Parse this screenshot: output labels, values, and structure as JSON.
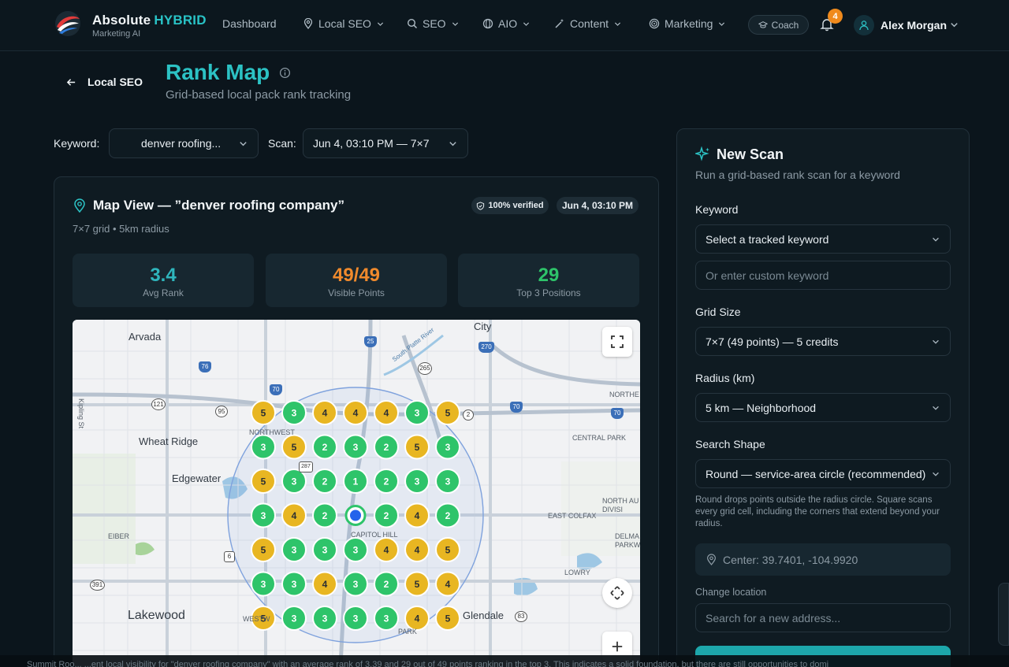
{
  "brand": {
    "name": "Absolute",
    "accent": "HYBRID",
    "sub": "Marketing AI"
  },
  "nav": {
    "items": [
      {
        "label": "Dashboard",
        "icon": "",
        "chevron": false
      },
      {
        "label": "Local SEO",
        "icon": "map-pin-icon",
        "chevron": true
      },
      {
        "label": "SEO",
        "icon": "search-icon",
        "chevron": true
      },
      {
        "label": "AIO",
        "icon": "globe-icon",
        "chevron": true
      },
      {
        "label": "Content",
        "icon": "magic-wand-icon",
        "chevron": true
      },
      {
        "label": "Marketing",
        "icon": "target-icon",
        "chevron": true
      }
    ],
    "coach": "Coach",
    "notifications": "4",
    "user": "Alex Morgan"
  },
  "header": {
    "back": "Local SEO",
    "title": "Rank Map",
    "subtitle": "Grid-based local pack rank tracking"
  },
  "filters": {
    "keyword_label": "Keyword:",
    "keyword_value": "denver roofing...",
    "scan_label": "Scan:",
    "scan_value": "Jun 4, 03:10 PM — 7×7"
  },
  "map_view": {
    "title": "Map View — ”denver roofing company”",
    "subtitle": "7×7 grid • 5km radius",
    "verified": "100% verified",
    "date": "Jun 4, 03:10 PM",
    "stats": [
      {
        "value": "3.4",
        "label": "Avg Rank",
        "color": "#2fb6bd"
      },
      {
        "value": "49/49",
        "label": "Visible Points",
        "color": "#f08a2c"
      },
      {
        "value": "29",
        "label": "Top 3 Positions",
        "color": "#2ec46a"
      }
    ],
    "grid_ranks": [
      [
        5,
        3,
        4,
        4,
        4,
        3,
        5
      ],
      [
        3,
        5,
        2,
        3,
        2,
        5,
        3
      ],
      [
        5,
        3,
        2,
        1,
        2,
        3,
        3
      ],
      [
        3,
        4,
        2,
        0,
        2,
        4,
        2
      ],
      [
        5,
        3,
        3,
        3,
        4,
        4,
        5
      ],
      [
        3,
        3,
        4,
        3,
        2,
        5,
        4
      ],
      [
        5,
        3,
        3,
        3,
        3,
        4,
        5
      ]
    ],
    "rank_colors": {
      "top3": "#2ec46a",
      "mid": "#e8b622",
      "center": "#2563eb"
    },
    "place_labels": [
      "Arvada",
      "Wheat Ridge",
      "Edgewater",
      "Lakewood",
      "Glendale",
      "City",
      "NORTHWEST",
      "CAPITOL HILL",
      "EAST COLFAX",
      "CENTRAL PARK",
      "NORTHE",
      "NORTH AU DIVISI",
      "DELMA PARKW",
      "LOWRY",
      "EIBER",
      "Kipling St",
      "South Platte River",
      "WESTW",
      "PARK"
    ],
    "route_shields": [
      "76",
      "70",
      "25",
      "270",
      "265",
      "121",
      "95",
      "287",
      "2",
      "6",
      "391",
      "83",
      "70",
      "70"
    ]
  },
  "new_scan": {
    "title": "New Scan",
    "subtitle": "Run a grid-based rank scan for a keyword",
    "keyword_label": "Keyword",
    "keyword_select": "Select a tracked keyword",
    "keyword_placeholder": "Or enter custom keyword",
    "grid_label": "Grid Size",
    "grid_value": "7×7 (49 points) — 5 credits",
    "radius_label": "Radius (km)",
    "radius_value": "5 km — Neighborhood",
    "shape_label": "Search Shape",
    "shape_value": "Round — service-area circle (recommended)",
    "shape_hint": "Round drops points outside the radius circle. Square scans every grid cell, including the corners that extend beyond your radius.",
    "center": "Center: 39.7401, -104.9920",
    "change_label": "Change location",
    "address_placeholder": "Search for a new address..."
  },
  "ticker": "Summit Roo... ...ent local visibility for \"denver roofing company\" with an average rank of 3.39 and 29 out of 49 points ranking in the top 3. This indicates a solid foundation, but there are still opportunities to domi"
}
